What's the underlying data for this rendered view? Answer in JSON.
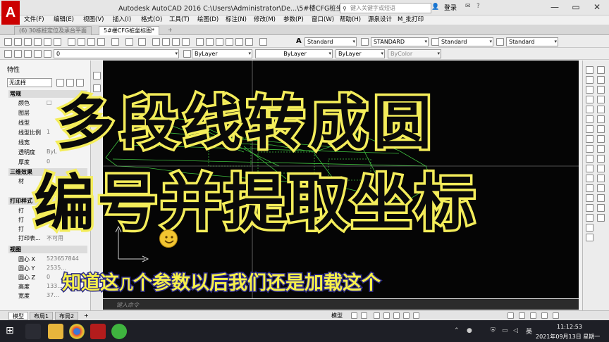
{
  "window": {
    "logo": "A",
    "title": "Autodesk AutoCAD 2016      C:\\Users\\Administrator\\De...\\5#楼CFG桩坐标图.dwg",
    "search_placeholder": "键入关键字或短语",
    "login": "登录",
    "controls": [
      "—",
      "▭",
      "✕"
    ]
  },
  "menu": [
    "文件(F)",
    "编辑(E)",
    "视图(V)",
    "插入(I)",
    "格式(O)",
    "工具(T)",
    "绘图(D)",
    "标注(N)",
    "修改(M)",
    "参数(P)",
    "窗口(W)",
    "帮助(H)",
    "源泉设计",
    "M_批打印"
  ],
  "doc_tabs": [
    {
      "label": "(6) 30栋桩定位及承台平面",
      "active": false
    },
    {
      "label": "5#楼CFG桩坐标图*",
      "active": true
    },
    {
      "label": "+",
      "active": false
    }
  ],
  "toolbar_row1": {
    "text_style": "Standard",
    "dim_style": "STANDARD",
    "table_style": "Standard",
    "multileader_style": "Standard"
  },
  "toolbar_row2": {
    "layer": "0",
    "color": "ByLayer",
    "linetype": "ByLayer",
    "lineweight": "ByLayer",
    "plot_style": "ByColor"
  },
  "properties": {
    "title": "特性",
    "selection": "无选择",
    "sections": {
      "general": "常规",
      "3d": "三维效果",
      "print": "打印样式",
      "view": "视图"
    },
    "general_rows": [
      {
        "label": "颜色",
        "value": "□"
      },
      {
        "label": "图层",
        "value": ""
      },
      {
        "label": "线型",
        "value": ""
      },
      {
        "label": "线型比例",
        "value": "1"
      },
      {
        "label": "线宽",
        "value": ""
      },
      {
        "label": "透明度",
        "value": "ByL"
      },
      {
        "label": "厚度",
        "value": "0"
      }
    ],
    "threed_row": {
      "label": "材",
      "value": ""
    },
    "print_rows": [
      {
        "label": "打",
        "value": ""
      },
      {
        "label": "打",
        "value": ""
      },
      {
        "label": "打",
        "value": ""
      },
      {
        "label": "打印表...",
        "value": "不可用"
      }
    ],
    "view_rows": [
      {
        "label": "圆心 X",
        "value": "523657844"
      },
      {
        "label": "圆心 Y",
        "value": "2535..."
      },
      {
        "label": "圆心 Z",
        "value": "0"
      },
      {
        "label": "高度",
        "value": "133..."
      },
      {
        "label": "宽度",
        "value": "37..."
      }
    ]
  },
  "command_placeholder": "键入命令",
  "status": {
    "layout_tabs": [
      {
        "label": "模型",
        "active": true
      },
      {
        "label": "布局1",
        "active": false
      },
      {
        "label": "布局2",
        "active": false
      },
      {
        "label": "+",
        "active": false
      }
    ],
    "model": "模型"
  },
  "taskbar": {
    "lang": "英",
    "time": "11:12:53",
    "date": "2021年09月13日 星期一"
  },
  "overlay": {
    "line1": "多段线转成圆",
    "line2": "编号并提取坐标",
    "subtitle_pre": "知道这",
    "subtitle_small": "几",
    "subtitle_post": "个参数以后我们还是加载这个"
  },
  "colors": {
    "overlay_text": "#0a0a0a",
    "overlay_outline": "#f4ed5a",
    "subtitle_fill": "#f6f04a",
    "subtitle_outline": "#2c2a88",
    "canvas_bg": "#050505",
    "drawing_lines": "#3fbf3f"
  }
}
